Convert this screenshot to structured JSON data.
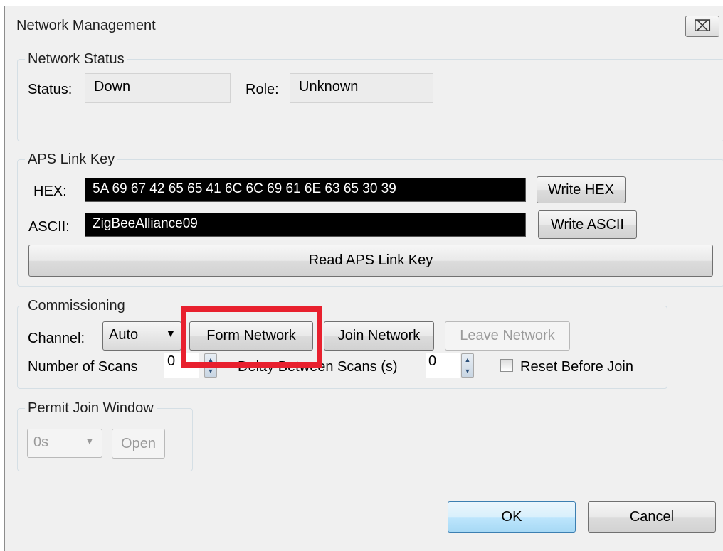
{
  "window": {
    "title": "Network Management",
    "close_glyph": "⌧"
  },
  "network_status": {
    "legend": "Network Status",
    "status_label": "Status:",
    "status_value": "Down",
    "role_label": "Role:",
    "role_value": "Unknown"
  },
  "aps_link_key": {
    "legend": "APS Link Key",
    "hex_label": "HEX:",
    "hex_value": "5A 69 67 42 65 65 41 6C 6C 69 61 6E 63 65 30 39",
    "write_hex": "Write HEX",
    "ascii_label": "ASCII:",
    "ascii_value": "ZigBeeAlliance09",
    "write_ascii": "Write ASCII",
    "read_key": "Read APS Link Key"
  },
  "commissioning": {
    "legend": "Commissioning",
    "channel_label": "Channel:",
    "channel_value": "Auto",
    "form_network": "Form Network",
    "join_network": "Join Network",
    "leave_network": "Leave Network",
    "scans_label": "Number of Scans",
    "scans_value": "0",
    "delay_label": "Delay Between Scans (s)",
    "delay_value": "0",
    "reset_label": "Reset Before Join",
    "reset_checked": false
  },
  "permit_join": {
    "legend": "Permit Join Window",
    "duration_value": "0s",
    "open_label": "Open"
  },
  "footer": {
    "ok": "OK",
    "cancel": "Cancel"
  },
  "colors": {
    "highlight": "#e8202e",
    "key_field_bg": "#000000",
    "dialog_bg": "#f0f0f0"
  }
}
